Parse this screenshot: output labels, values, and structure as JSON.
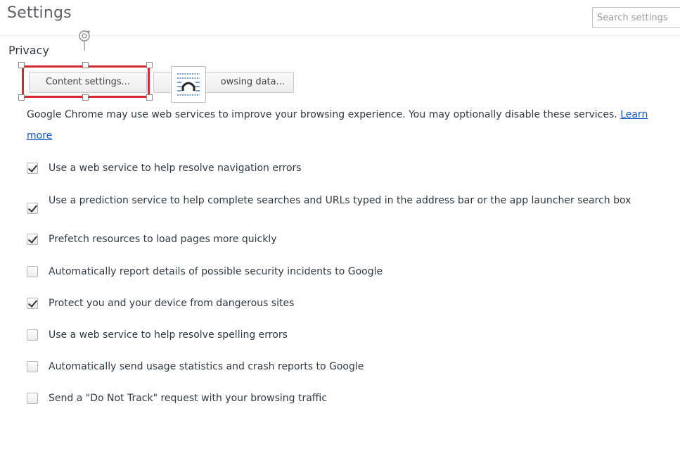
{
  "header": {
    "title": "Settings",
    "search_placeholder": "Search settings"
  },
  "privacy": {
    "title": "Privacy",
    "content_settings_label": "Content settings...",
    "clear_browsing_label": "owsing data...",
    "description": "Google Chrome may use web services to improve your browsing experience. You may optionally disable these services.",
    "learn_more": "Learn more",
    "options": [
      {
        "label": "Use a web service to help resolve navigation errors",
        "checked": true
      },
      {
        "label": "Use a prediction service to help complete searches and URLs typed in the address bar or the app launcher search box",
        "checked": true
      },
      {
        "label": "Prefetch resources to load pages more quickly",
        "checked": true
      },
      {
        "label": "Automatically report details of possible security incidents to Google",
        "checked": false
      },
      {
        "label": "Protect you and your device from dangerous sites",
        "checked": true
      },
      {
        "label": "Use a web service to help resolve spelling errors",
        "checked": false
      },
      {
        "label": "Automatically send usage statistics and crash reports to Google",
        "checked": false
      },
      {
        "label": "Send a \"Do Not Track\" request with your browsing traffic",
        "checked": false
      }
    ]
  },
  "overlay": {
    "selection_color": "#d7282f",
    "icon": "text-wrap-icon",
    "cursor_icon": "rotate-cursor-icon"
  }
}
